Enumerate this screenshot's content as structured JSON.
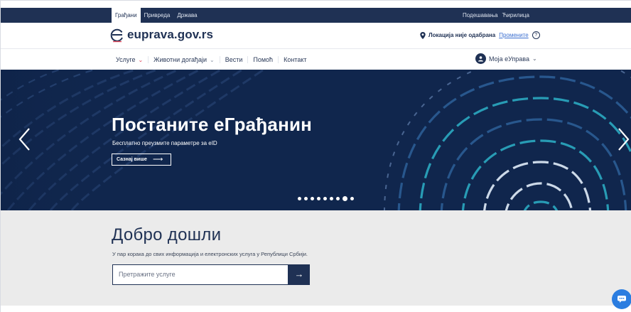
{
  "topbar": {
    "tabs": [
      "Грађани",
      "Привреда",
      "Држава"
    ],
    "settings": "Подешавања",
    "script": "Ћирилица"
  },
  "header": {
    "logo_text": "euprava.gov.rs",
    "location_text": "Локација није одабрана",
    "change_link": "Промените",
    "help_icon": "?"
  },
  "nav": {
    "items": [
      "Услуге",
      "Животни догађаји",
      "Вести",
      "Помоћ",
      "Контакт"
    ],
    "account": "Моја еУправа"
  },
  "hero": {
    "title": "Постаните еГрађанин",
    "subtitle": "Бесплатно преузмите параметре за eID",
    "cta": "Сазнај више",
    "slide_count": 9,
    "active_slide": 8
  },
  "welcome": {
    "heading": "Добро дошли",
    "lead": "У пар корака до свих информација и електронских услуга у Републици Србији.",
    "search_placeholder": "Претражите услуге"
  },
  "colors": {
    "navy": "#1f3154",
    "hero_bg": "#10264d",
    "accent_red": "#e0465a",
    "teal": "#2aa3bb",
    "chat_blue": "#2b7de0",
    "welcome_bg": "#ebebeb"
  }
}
